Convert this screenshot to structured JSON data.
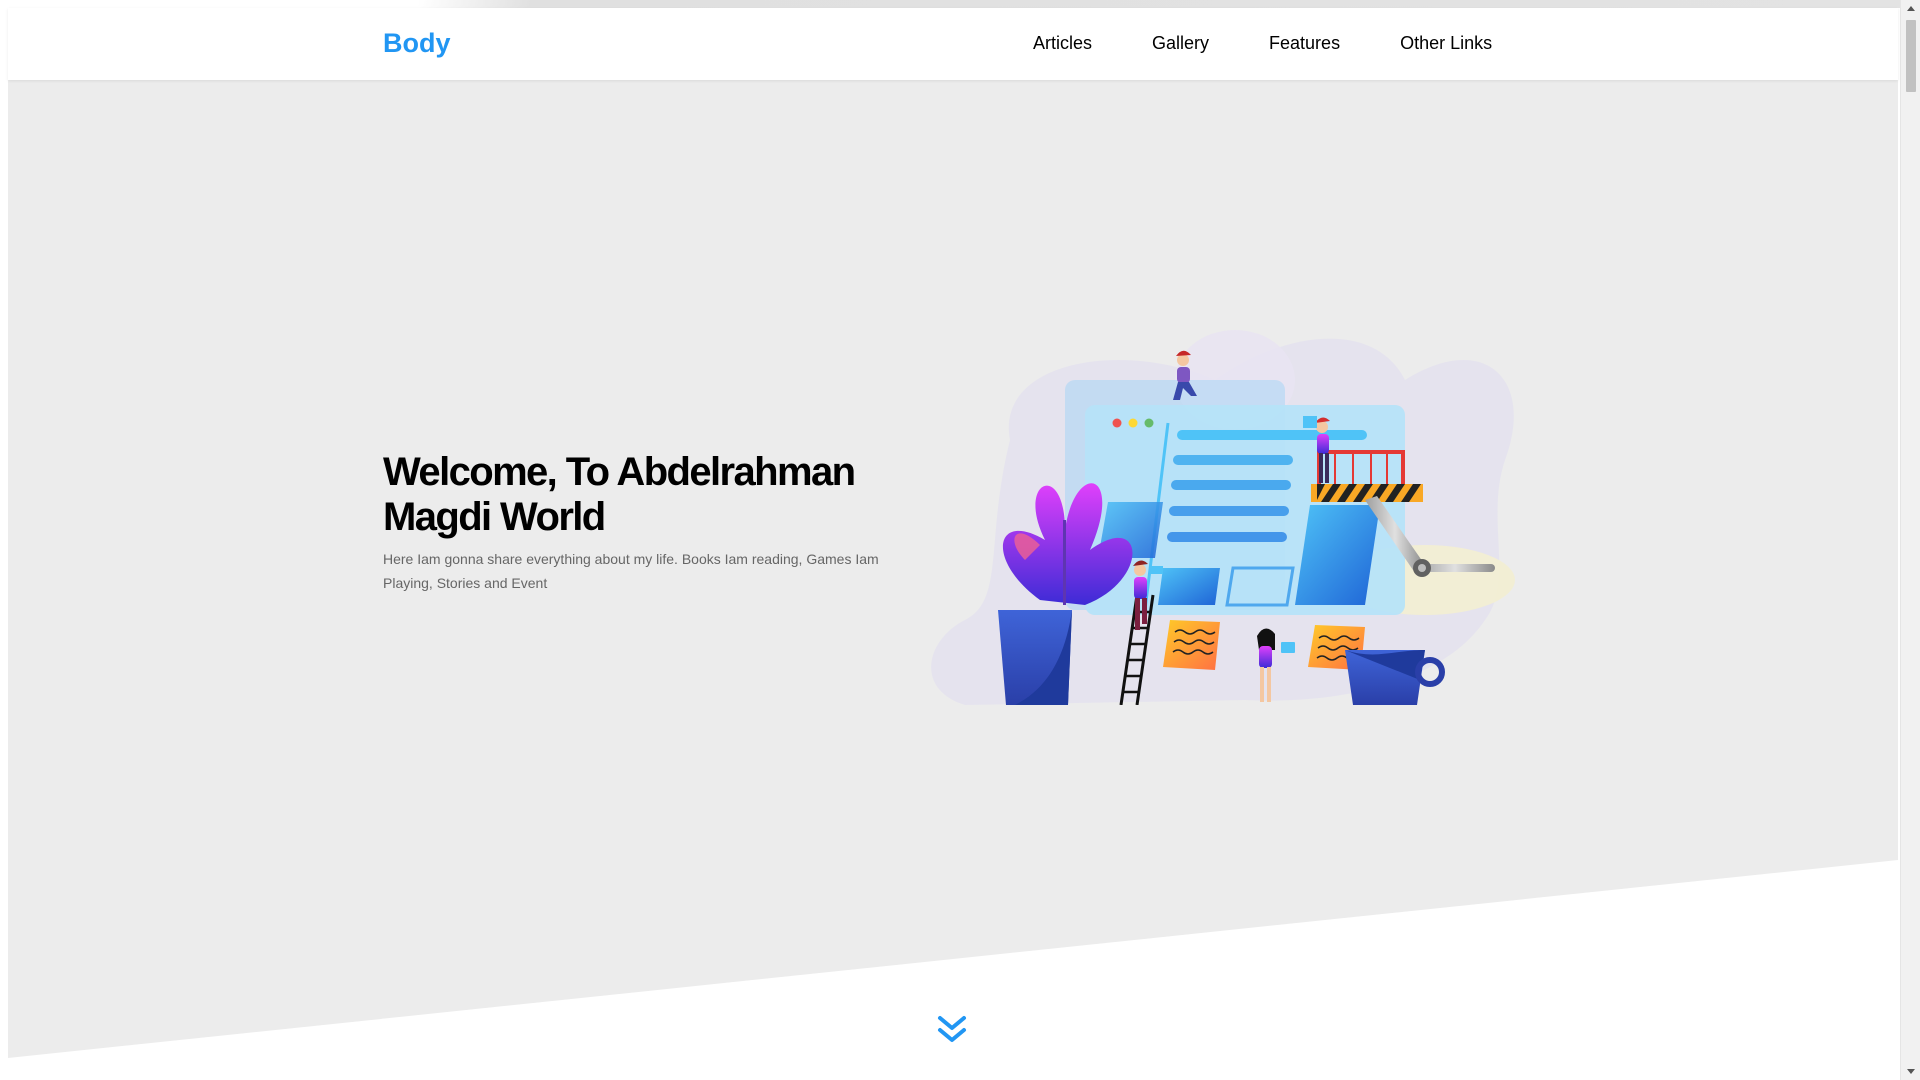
{
  "header": {
    "logo": "Body",
    "nav": [
      "Articles",
      "Gallery",
      "Features",
      "Other Links"
    ]
  },
  "hero": {
    "title": "Welcome, To Abdelrahman Magdi World",
    "description": "Here Iam gonna share everything about my life. Books Iam reading, Games Iam Playing, Stories and Event",
    "illustration": "landing-page-illustration"
  },
  "icons": {
    "scroll_down": "double-chevron-down-icon"
  },
  "colors": {
    "accent": "#2196f3",
    "hero_background": "#ececec",
    "header_background": "#ffffff",
    "text": "#000000",
    "muted_text": "#666666"
  }
}
